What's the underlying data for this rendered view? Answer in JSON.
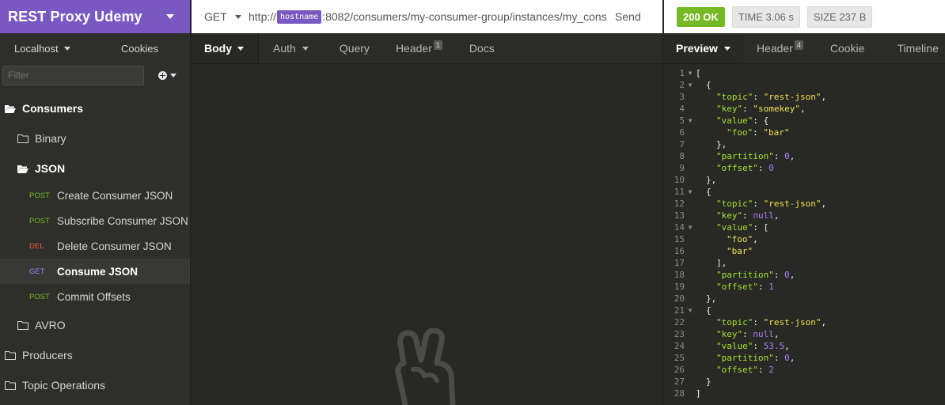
{
  "workspace": {
    "title": "REST Proxy Udemy"
  },
  "sidebar": {
    "environment": "Localhost",
    "cookies_label": "Cookies",
    "filter_placeholder": "Filter",
    "tree": {
      "consumers": "Consumers",
      "binary": "Binary",
      "json": "JSON",
      "avro": "AVRO",
      "producers": "Producers",
      "topic_operations": "Topic Operations"
    },
    "requests": [
      {
        "method": "POST",
        "name": "Create Consumer JSON"
      },
      {
        "method": "POST",
        "name": "Subscribe Consumer JSON"
      },
      {
        "method": "DEL",
        "name": "Delete Consumer JSON"
      },
      {
        "method": "GET",
        "name": "Consume JSON"
      },
      {
        "method": "POST",
        "name": "Commit Offsets"
      }
    ]
  },
  "request": {
    "method": "GET",
    "url_prefix": "http://",
    "url_variable": "hostname",
    "url_suffix": ":8082/consumers/my-consumer-group/instances/my_cons",
    "send_label": "Send",
    "tabs": {
      "body": "Body",
      "auth": "Auth",
      "query": "Query",
      "header": "Header",
      "header_count": "1",
      "docs": "Docs"
    }
  },
  "response": {
    "status": "200 OK",
    "time_label": "TIME",
    "time_value": "3.06 s",
    "size_label": "SIZE",
    "size_value": "237 B",
    "tabs": {
      "preview": "Preview",
      "header": "Header",
      "header_count": "4",
      "cookie": "Cookie",
      "timeline": "Timeline"
    },
    "code_lines": [
      {
        "n": "1",
        "fold": true,
        "ind": 0,
        "tokens": [
          [
            "p",
            "["
          ]
        ]
      },
      {
        "n": "2",
        "fold": true,
        "ind": 1,
        "tokens": [
          [
            "p",
            "{"
          ]
        ]
      },
      {
        "n": "3",
        "fold": false,
        "ind": 2,
        "tokens": [
          [
            "k",
            "\"topic\""
          ],
          [
            "p",
            ": "
          ],
          [
            "s",
            "\"rest-json\""
          ],
          [
            "p",
            ","
          ]
        ]
      },
      {
        "n": "4",
        "fold": false,
        "ind": 2,
        "tokens": [
          [
            "k",
            "\"key\""
          ],
          [
            "p",
            ": "
          ],
          [
            "s",
            "\"somekey\""
          ],
          [
            "p",
            ","
          ]
        ]
      },
      {
        "n": "5",
        "fold": true,
        "ind": 2,
        "tokens": [
          [
            "k",
            "\"value\""
          ],
          [
            "p",
            ": {"
          ]
        ]
      },
      {
        "n": "6",
        "fold": false,
        "ind": 3,
        "tokens": [
          [
            "k",
            "\"foo\""
          ],
          [
            "p",
            ": "
          ],
          [
            "s",
            "\"bar\""
          ]
        ]
      },
      {
        "n": "7",
        "fold": false,
        "ind": 2,
        "tokens": [
          [
            "p",
            "},"
          ]
        ]
      },
      {
        "n": "8",
        "fold": false,
        "ind": 2,
        "tokens": [
          [
            "k",
            "\"partition\""
          ],
          [
            "p",
            ": "
          ],
          [
            "n",
            "0"
          ],
          [
            "p",
            ","
          ]
        ]
      },
      {
        "n": "9",
        "fold": false,
        "ind": 2,
        "tokens": [
          [
            "k",
            "\"offset\""
          ],
          [
            "p",
            ": "
          ],
          [
            "n",
            "0"
          ]
        ]
      },
      {
        "n": "10",
        "fold": false,
        "ind": 1,
        "tokens": [
          [
            "p",
            "},"
          ]
        ]
      },
      {
        "n": "11",
        "fold": true,
        "ind": 1,
        "tokens": [
          [
            "p",
            "{"
          ]
        ]
      },
      {
        "n": "12",
        "fold": false,
        "ind": 2,
        "tokens": [
          [
            "k",
            "\"topic\""
          ],
          [
            "p",
            ": "
          ],
          [
            "s",
            "\"rest-json\""
          ],
          [
            "p",
            ","
          ]
        ]
      },
      {
        "n": "13",
        "fold": false,
        "ind": 2,
        "tokens": [
          [
            "k",
            "\"key\""
          ],
          [
            "p",
            ": "
          ],
          [
            "n",
            "null"
          ],
          [
            "p",
            ","
          ]
        ]
      },
      {
        "n": "14",
        "fold": true,
        "ind": 2,
        "tokens": [
          [
            "k",
            "\"value\""
          ],
          [
            "p",
            ": ["
          ]
        ]
      },
      {
        "n": "15",
        "fold": false,
        "ind": 3,
        "tokens": [
          [
            "s",
            "\"foo\""
          ],
          [
            "p",
            ","
          ]
        ]
      },
      {
        "n": "16",
        "fold": false,
        "ind": 3,
        "tokens": [
          [
            "s",
            "\"bar\""
          ]
        ]
      },
      {
        "n": "17",
        "fold": false,
        "ind": 2,
        "tokens": [
          [
            "p",
            "],"
          ]
        ]
      },
      {
        "n": "18",
        "fold": false,
        "ind": 2,
        "tokens": [
          [
            "k",
            "\"partition\""
          ],
          [
            "p",
            ": "
          ],
          [
            "n",
            "0"
          ],
          [
            "p",
            ","
          ]
        ]
      },
      {
        "n": "19",
        "fold": false,
        "ind": 2,
        "tokens": [
          [
            "k",
            "\"offset\""
          ],
          [
            "p",
            ": "
          ],
          [
            "n",
            "1"
          ]
        ]
      },
      {
        "n": "20",
        "fold": false,
        "ind": 1,
        "tokens": [
          [
            "p",
            "},"
          ]
        ]
      },
      {
        "n": "21",
        "fold": true,
        "ind": 1,
        "tokens": [
          [
            "p",
            "{"
          ]
        ]
      },
      {
        "n": "22",
        "fold": false,
        "ind": 2,
        "tokens": [
          [
            "k",
            "\"topic\""
          ],
          [
            "p",
            ": "
          ],
          [
            "s",
            "\"rest-json\""
          ],
          [
            "p",
            ","
          ]
        ]
      },
      {
        "n": "23",
        "fold": false,
        "ind": 2,
        "tokens": [
          [
            "k",
            "\"key\""
          ],
          [
            "p",
            ": "
          ],
          [
            "n",
            "null"
          ],
          [
            "p",
            ","
          ]
        ]
      },
      {
        "n": "24",
        "fold": false,
        "ind": 2,
        "tokens": [
          [
            "k",
            "\"value\""
          ],
          [
            "p",
            ": "
          ],
          [
            "n",
            "53.5"
          ],
          [
            "p",
            ","
          ]
        ]
      },
      {
        "n": "25",
        "fold": false,
        "ind": 2,
        "tokens": [
          [
            "k",
            "\"partition\""
          ],
          [
            "p",
            ": "
          ],
          [
            "n",
            "0"
          ],
          [
            "p",
            ","
          ]
        ]
      },
      {
        "n": "26",
        "fold": false,
        "ind": 2,
        "tokens": [
          [
            "k",
            "\"offset\""
          ],
          [
            "p",
            ": "
          ],
          [
            "n",
            "2"
          ]
        ]
      },
      {
        "n": "27",
        "fold": false,
        "ind": 1,
        "tokens": [
          [
            "p",
            "}"
          ]
        ]
      },
      {
        "n": "28",
        "fold": false,
        "ind": 0,
        "tokens": [
          [
            "p",
            "]"
          ]
        ]
      }
    ]
  },
  "colors": {
    "accent": "#7a58c2",
    "ok": "#75ba24",
    "post": "#75ba24",
    "delete": "#ef5b3d",
    "get": "#8e8bf0"
  }
}
